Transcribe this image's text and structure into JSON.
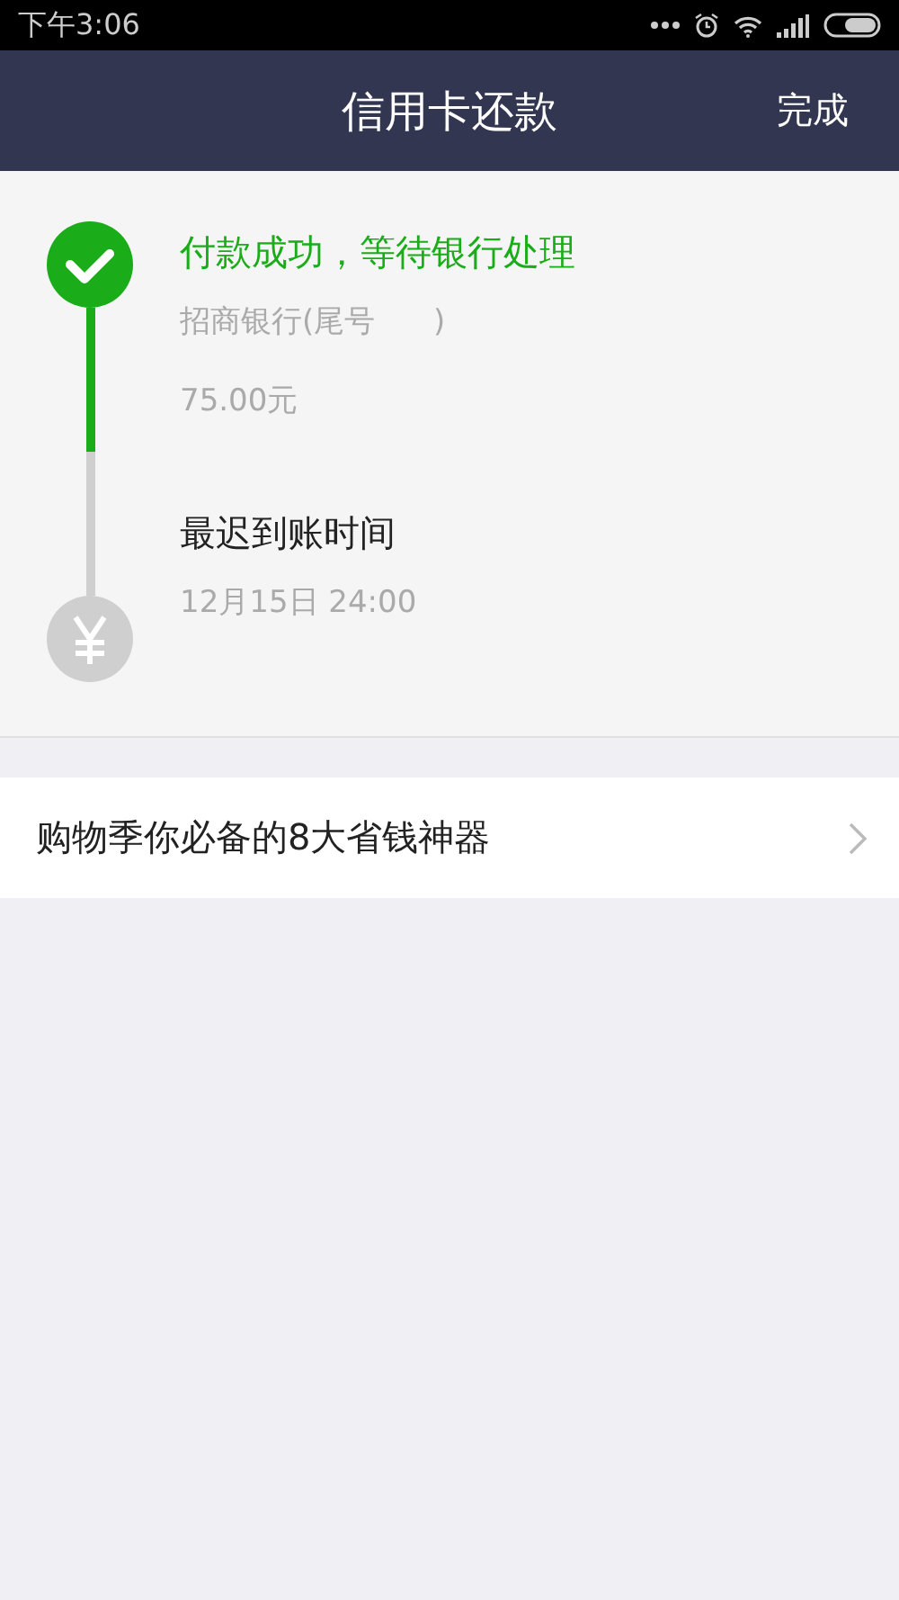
{
  "status_bar": {
    "time": "下午3:06"
  },
  "nav_bar": {
    "title": "信用卡还款",
    "action": "完成"
  },
  "steps": [
    {
      "title": "付款成功，等待银行处理",
      "done": true,
      "details": [
        "招商银行(尾号      )",
        "75.00元"
      ]
    },
    {
      "title": "最迟到账时间",
      "done": false,
      "details": [
        "12月15日 24:00"
      ]
    }
  ],
  "promo": {
    "label": "购物季你必备的8大省钱神器"
  }
}
